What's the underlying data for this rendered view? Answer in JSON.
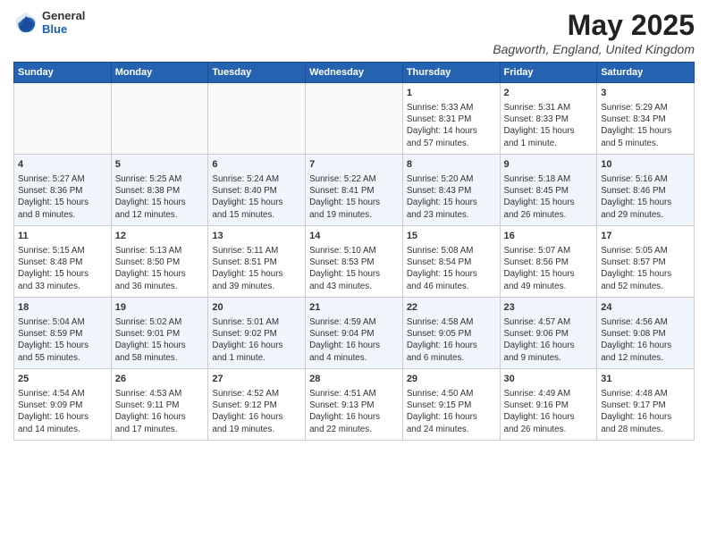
{
  "header": {
    "logo_general": "General",
    "logo_blue": "Blue",
    "month": "May 2025",
    "location": "Bagworth, England, United Kingdom"
  },
  "days_of_week": [
    "Sunday",
    "Monday",
    "Tuesday",
    "Wednesday",
    "Thursday",
    "Friday",
    "Saturday"
  ],
  "weeks": [
    [
      {
        "day": "",
        "info": ""
      },
      {
        "day": "",
        "info": ""
      },
      {
        "day": "",
        "info": ""
      },
      {
        "day": "",
        "info": ""
      },
      {
        "day": "1",
        "info": "Sunrise: 5:33 AM\nSunset: 8:31 PM\nDaylight: 14 hours\nand 57 minutes."
      },
      {
        "day": "2",
        "info": "Sunrise: 5:31 AM\nSunset: 8:33 PM\nDaylight: 15 hours\nand 1 minute."
      },
      {
        "day": "3",
        "info": "Sunrise: 5:29 AM\nSunset: 8:34 PM\nDaylight: 15 hours\nand 5 minutes."
      }
    ],
    [
      {
        "day": "4",
        "info": "Sunrise: 5:27 AM\nSunset: 8:36 PM\nDaylight: 15 hours\nand 8 minutes."
      },
      {
        "day": "5",
        "info": "Sunrise: 5:25 AM\nSunset: 8:38 PM\nDaylight: 15 hours\nand 12 minutes."
      },
      {
        "day": "6",
        "info": "Sunrise: 5:24 AM\nSunset: 8:40 PM\nDaylight: 15 hours\nand 15 minutes."
      },
      {
        "day": "7",
        "info": "Sunrise: 5:22 AM\nSunset: 8:41 PM\nDaylight: 15 hours\nand 19 minutes."
      },
      {
        "day": "8",
        "info": "Sunrise: 5:20 AM\nSunset: 8:43 PM\nDaylight: 15 hours\nand 23 minutes."
      },
      {
        "day": "9",
        "info": "Sunrise: 5:18 AM\nSunset: 8:45 PM\nDaylight: 15 hours\nand 26 minutes."
      },
      {
        "day": "10",
        "info": "Sunrise: 5:16 AM\nSunset: 8:46 PM\nDaylight: 15 hours\nand 29 minutes."
      }
    ],
    [
      {
        "day": "11",
        "info": "Sunrise: 5:15 AM\nSunset: 8:48 PM\nDaylight: 15 hours\nand 33 minutes."
      },
      {
        "day": "12",
        "info": "Sunrise: 5:13 AM\nSunset: 8:50 PM\nDaylight: 15 hours\nand 36 minutes."
      },
      {
        "day": "13",
        "info": "Sunrise: 5:11 AM\nSunset: 8:51 PM\nDaylight: 15 hours\nand 39 minutes."
      },
      {
        "day": "14",
        "info": "Sunrise: 5:10 AM\nSunset: 8:53 PM\nDaylight: 15 hours\nand 43 minutes."
      },
      {
        "day": "15",
        "info": "Sunrise: 5:08 AM\nSunset: 8:54 PM\nDaylight: 15 hours\nand 46 minutes."
      },
      {
        "day": "16",
        "info": "Sunrise: 5:07 AM\nSunset: 8:56 PM\nDaylight: 15 hours\nand 49 minutes."
      },
      {
        "day": "17",
        "info": "Sunrise: 5:05 AM\nSunset: 8:57 PM\nDaylight: 15 hours\nand 52 minutes."
      }
    ],
    [
      {
        "day": "18",
        "info": "Sunrise: 5:04 AM\nSunset: 8:59 PM\nDaylight: 15 hours\nand 55 minutes."
      },
      {
        "day": "19",
        "info": "Sunrise: 5:02 AM\nSunset: 9:01 PM\nDaylight: 15 hours\nand 58 minutes."
      },
      {
        "day": "20",
        "info": "Sunrise: 5:01 AM\nSunset: 9:02 PM\nDaylight: 16 hours\nand 1 minute."
      },
      {
        "day": "21",
        "info": "Sunrise: 4:59 AM\nSunset: 9:04 PM\nDaylight: 16 hours\nand 4 minutes."
      },
      {
        "day": "22",
        "info": "Sunrise: 4:58 AM\nSunset: 9:05 PM\nDaylight: 16 hours\nand 6 minutes."
      },
      {
        "day": "23",
        "info": "Sunrise: 4:57 AM\nSunset: 9:06 PM\nDaylight: 16 hours\nand 9 minutes."
      },
      {
        "day": "24",
        "info": "Sunrise: 4:56 AM\nSunset: 9:08 PM\nDaylight: 16 hours\nand 12 minutes."
      }
    ],
    [
      {
        "day": "25",
        "info": "Sunrise: 4:54 AM\nSunset: 9:09 PM\nDaylight: 16 hours\nand 14 minutes."
      },
      {
        "day": "26",
        "info": "Sunrise: 4:53 AM\nSunset: 9:11 PM\nDaylight: 16 hours\nand 17 minutes."
      },
      {
        "day": "27",
        "info": "Sunrise: 4:52 AM\nSunset: 9:12 PM\nDaylight: 16 hours\nand 19 minutes."
      },
      {
        "day": "28",
        "info": "Sunrise: 4:51 AM\nSunset: 9:13 PM\nDaylight: 16 hours\nand 22 minutes."
      },
      {
        "day": "29",
        "info": "Sunrise: 4:50 AM\nSunset: 9:15 PM\nDaylight: 16 hours\nand 24 minutes."
      },
      {
        "day": "30",
        "info": "Sunrise: 4:49 AM\nSunset: 9:16 PM\nDaylight: 16 hours\nand 26 minutes."
      },
      {
        "day": "31",
        "info": "Sunrise: 4:48 AM\nSunset: 9:17 PM\nDaylight: 16 hours\nand 28 minutes."
      }
    ]
  ]
}
